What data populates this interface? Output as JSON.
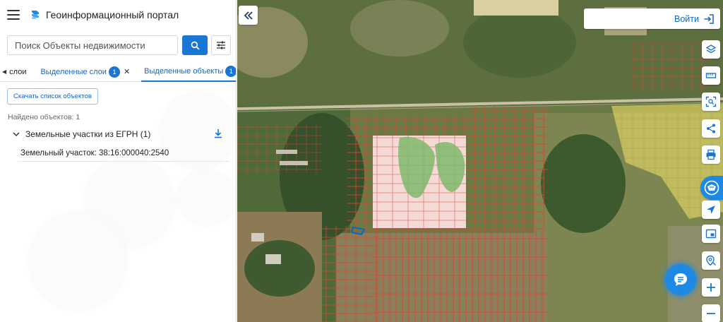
{
  "header": {
    "menu_icon": "hamburger-menu-icon",
    "logo_icon": "portal-logo-icon",
    "title": "Геоинформационный портал"
  },
  "search": {
    "placeholder": "Поиск Объекты недвижимости",
    "value": "",
    "button_icon": "search-icon",
    "filter_icon": "sliders-icon"
  },
  "tabs": [
    {
      "label": "слои",
      "badge": "",
      "closable": false,
      "active": false
    },
    {
      "label": "Выделенные слои",
      "badge": "1",
      "closable": true,
      "active": false
    },
    {
      "label": "Выделенные объекты",
      "badge": "1",
      "closable": true,
      "active": true
    }
  ],
  "results": {
    "download_list_label": "Скачать список объектов",
    "found_text": "Найдено объектов: 1",
    "groups": [
      {
        "title": "Земельные участки из ЕГРН (1)",
        "expanded": true,
        "items": [
          "Земельный участок: 38:16:000040:2540"
        ]
      }
    ]
  },
  "map": {
    "login_label": "Войти",
    "login_icon": "login-icon",
    "collapse_icon": "double-chevron-left-icon",
    "tools": [
      "layers-icon",
      "ruler-icon",
      "select-area-icon",
      "share-icon",
      "print-icon",
      "cadastre-icon",
      "navigation-arrow-icon",
      "minimap-icon",
      "location-search-icon",
      "zoom-in-icon",
      "zoom-out-icon"
    ],
    "chat_icon": "chat-icon",
    "accent": "#1e88e5",
    "parcel_color": "#e0432f",
    "selected_parcel_color": "#1565c0"
  }
}
